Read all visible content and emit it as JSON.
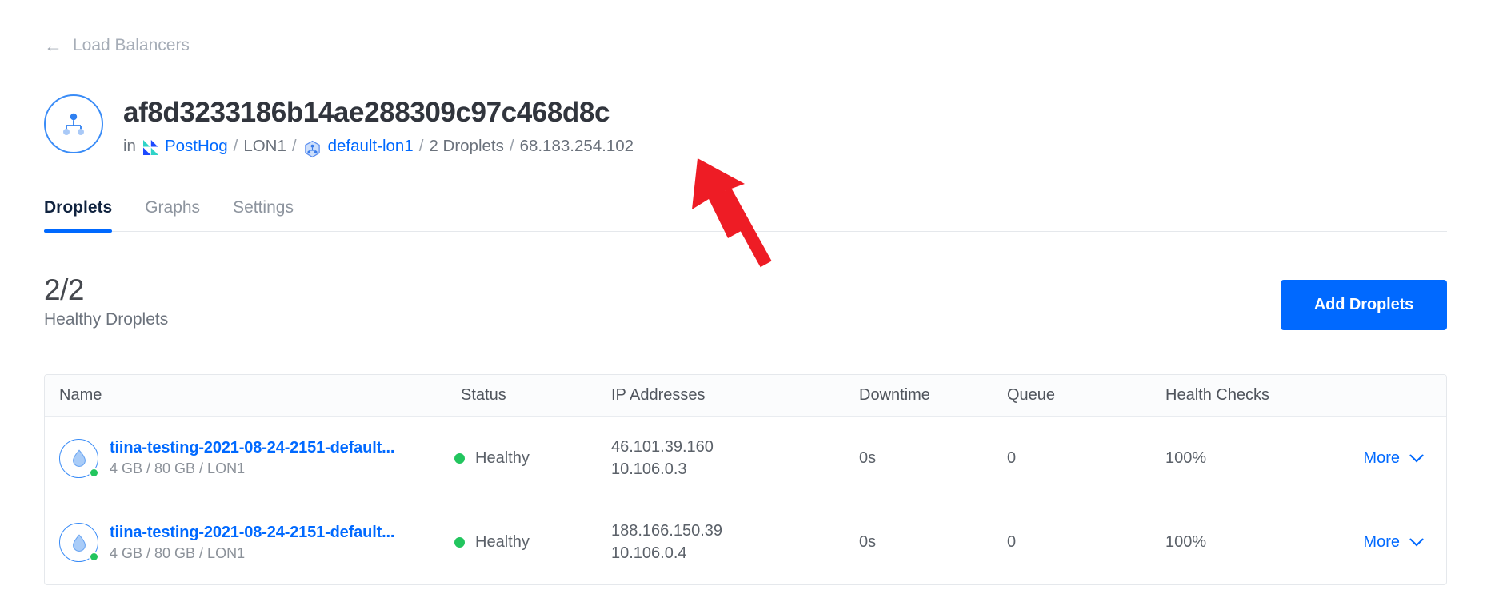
{
  "back": {
    "label": "Load Balancers",
    "icon": "arrow-left-icon"
  },
  "header": {
    "icon": "load-balancer-icon",
    "title": "af8d3233186b14ae288309c97c468d8c",
    "breadcrumb": {
      "prefix": "in",
      "project": "PostHog",
      "project_icon": "posthog-logo-icon",
      "region": "LON1",
      "vpc_icon": "vpc-network-icon",
      "vpc": "default-lon1",
      "droplets": "2 Droplets",
      "ip": "68.183.254.102",
      "separator": "/"
    }
  },
  "tabs": [
    {
      "label": "Droplets",
      "active": true
    },
    {
      "label": "Graphs",
      "active": false
    },
    {
      "label": "Settings",
      "active": false
    }
  ],
  "summary": {
    "count": "2/2",
    "label": "Healthy Droplets"
  },
  "actions": {
    "add_droplets": "Add Droplets",
    "accent_color": "#0069ff"
  },
  "table": {
    "columns": [
      "Name",
      "Status",
      "IP Addresses",
      "Downtime",
      "Queue",
      "Health Checks"
    ],
    "rows": [
      {
        "name": "tiina-testing-2021-08-24-2151-default...",
        "meta": "4 GB / 80 GB / LON1",
        "status": "Healthy",
        "status_color": "#22c55e",
        "ip_public": "46.101.39.160",
        "ip_private": "10.106.0.3",
        "downtime": "0s",
        "queue": "0",
        "health_checks": "100%",
        "more": "More"
      },
      {
        "name": "tiina-testing-2021-08-24-2151-default...",
        "meta": "4 GB / 80 GB / LON1",
        "status": "Healthy",
        "status_color": "#22c55e",
        "ip_public": "188.166.150.39",
        "ip_private": "10.106.0.4",
        "downtime": "0s",
        "queue": "0",
        "health_checks": "100%",
        "more": "More"
      }
    ]
  },
  "annotation": {
    "type": "arrow",
    "color": "#ee1c25",
    "points_at": "breadcrumb-ip"
  }
}
